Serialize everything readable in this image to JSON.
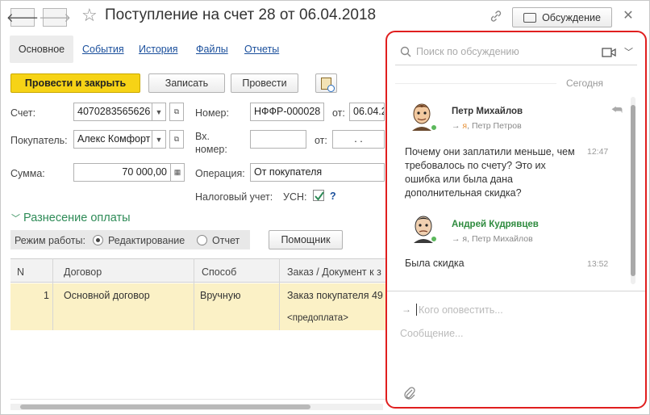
{
  "window": {
    "title": "Поступление на счет 28 от 06.04.2018",
    "discussion_button": "Обсуждение"
  },
  "tabs": [
    {
      "label": "Основное"
    },
    {
      "label": "События"
    },
    {
      "label": "История"
    },
    {
      "label": "Файлы"
    },
    {
      "label": "Отчеты"
    }
  ],
  "toolbar": {
    "post_close": "Провести и закрыть",
    "save": "Записать",
    "post": "Провести"
  },
  "form": {
    "account_label": "Счет:",
    "account_value": "4070283565626",
    "number_label": "Номер:",
    "number_value": "НФФР-000028",
    "from_label": "от:",
    "from_value": "06.04.2",
    "buyer_label": "Покупатель:",
    "buyer_value": "Алекс Комфорт",
    "in_number_label_1": "Вх.",
    "in_number_label_2": "номер:",
    "in_from_label": "от:",
    "in_from_value": ".  .",
    "sum_label": "Сумма:",
    "sum_value": "70 000,00",
    "operation_label": "Операция:",
    "operation_value": "От покупателя",
    "tax_label": "Налоговый учет:",
    "tax_system": "УСН:",
    "tax_help": "?"
  },
  "payment": {
    "section_title": "Разнесение оплаты",
    "mode_label": "Режим работы:",
    "mode_edit": "Редактирование",
    "mode_report": "Отчет",
    "assistant_button": "Помощник",
    "columns": [
      "N",
      "Договор",
      "Способ",
      "Заказ / Документ к з"
    ],
    "rows": [
      {
        "n": "1",
        "contract": "Основной договор",
        "method": "Вручную",
        "order": "Заказ покупателя 49",
        "order_sub": "<предоплата>"
      }
    ]
  },
  "discussion": {
    "search_placeholder": "Поиск по обсуждению",
    "date_header": "Сегодня",
    "messages": [
      {
        "author": "Петр Михайлов",
        "author_color": "#333333",
        "sub_me": "я",
        "sub_rest": ", Петр Петров",
        "text": "Почему они заплатили меньше, чем требовалось по счету? Это их ошибка или была дана дополнительная скидка?",
        "time": "12:47"
      },
      {
        "author": "Андрей Кудрявцев",
        "author_color": "#2e8b3e",
        "sub_me": "я",
        "sub_rest": ", Петр Михайлов",
        "text": "Была скидка",
        "time": "13:52"
      }
    ],
    "notify_placeholder": "Кого оповестить...",
    "message_placeholder": "Сообщение..."
  },
  "colors": {
    "accent_green": "#2e8b57",
    "primary_button": "#f6d316",
    "highlight_red": "#e01f1f",
    "selected_row": "#fbf1c6"
  }
}
